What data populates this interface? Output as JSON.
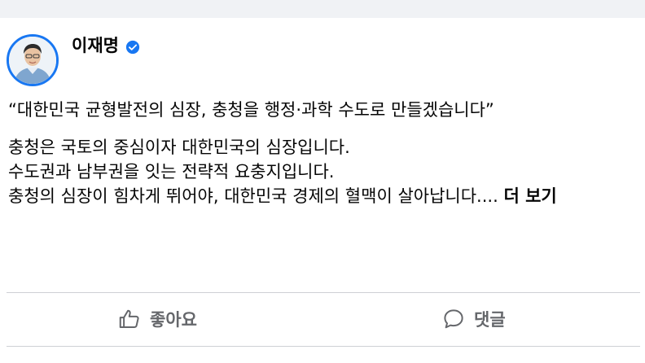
{
  "post": {
    "author": {
      "name": "이재명",
      "verified": true,
      "avatar_icon": "profile-photo-avatar",
      "verified_icon": "verified-badge-icon"
    },
    "headline": "“대한민국 균형발전의 심장, 충청을 행정·과학 수도로 만들겠습니다”",
    "body_lines": [
      "충청은 국토의 중심이자 대한민국의 심장입니다.",
      "수도권과 남부권을 잇는 전략적 요충지입니다.",
      "충청의 심장이 힘차게 뛰어야, 대한민국 경제의 혈맥이 살아납니다...."
    ],
    "see_more_label": "더 보기"
  },
  "actions": {
    "like": {
      "label": "좋아요",
      "icon": "thumbs-up-icon"
    },
    "comment": {
      "label": "댓글",
      "icon": "comment-bubble-icon"
    }
  },
  "colors": {
    "accent": "#1877f2",
    "text_primary": "#050505",
    "text_secondary": "#65676b",
    "divider": "#ced0d4",
    "top_strip": "#f0f2f5"
  }
}
